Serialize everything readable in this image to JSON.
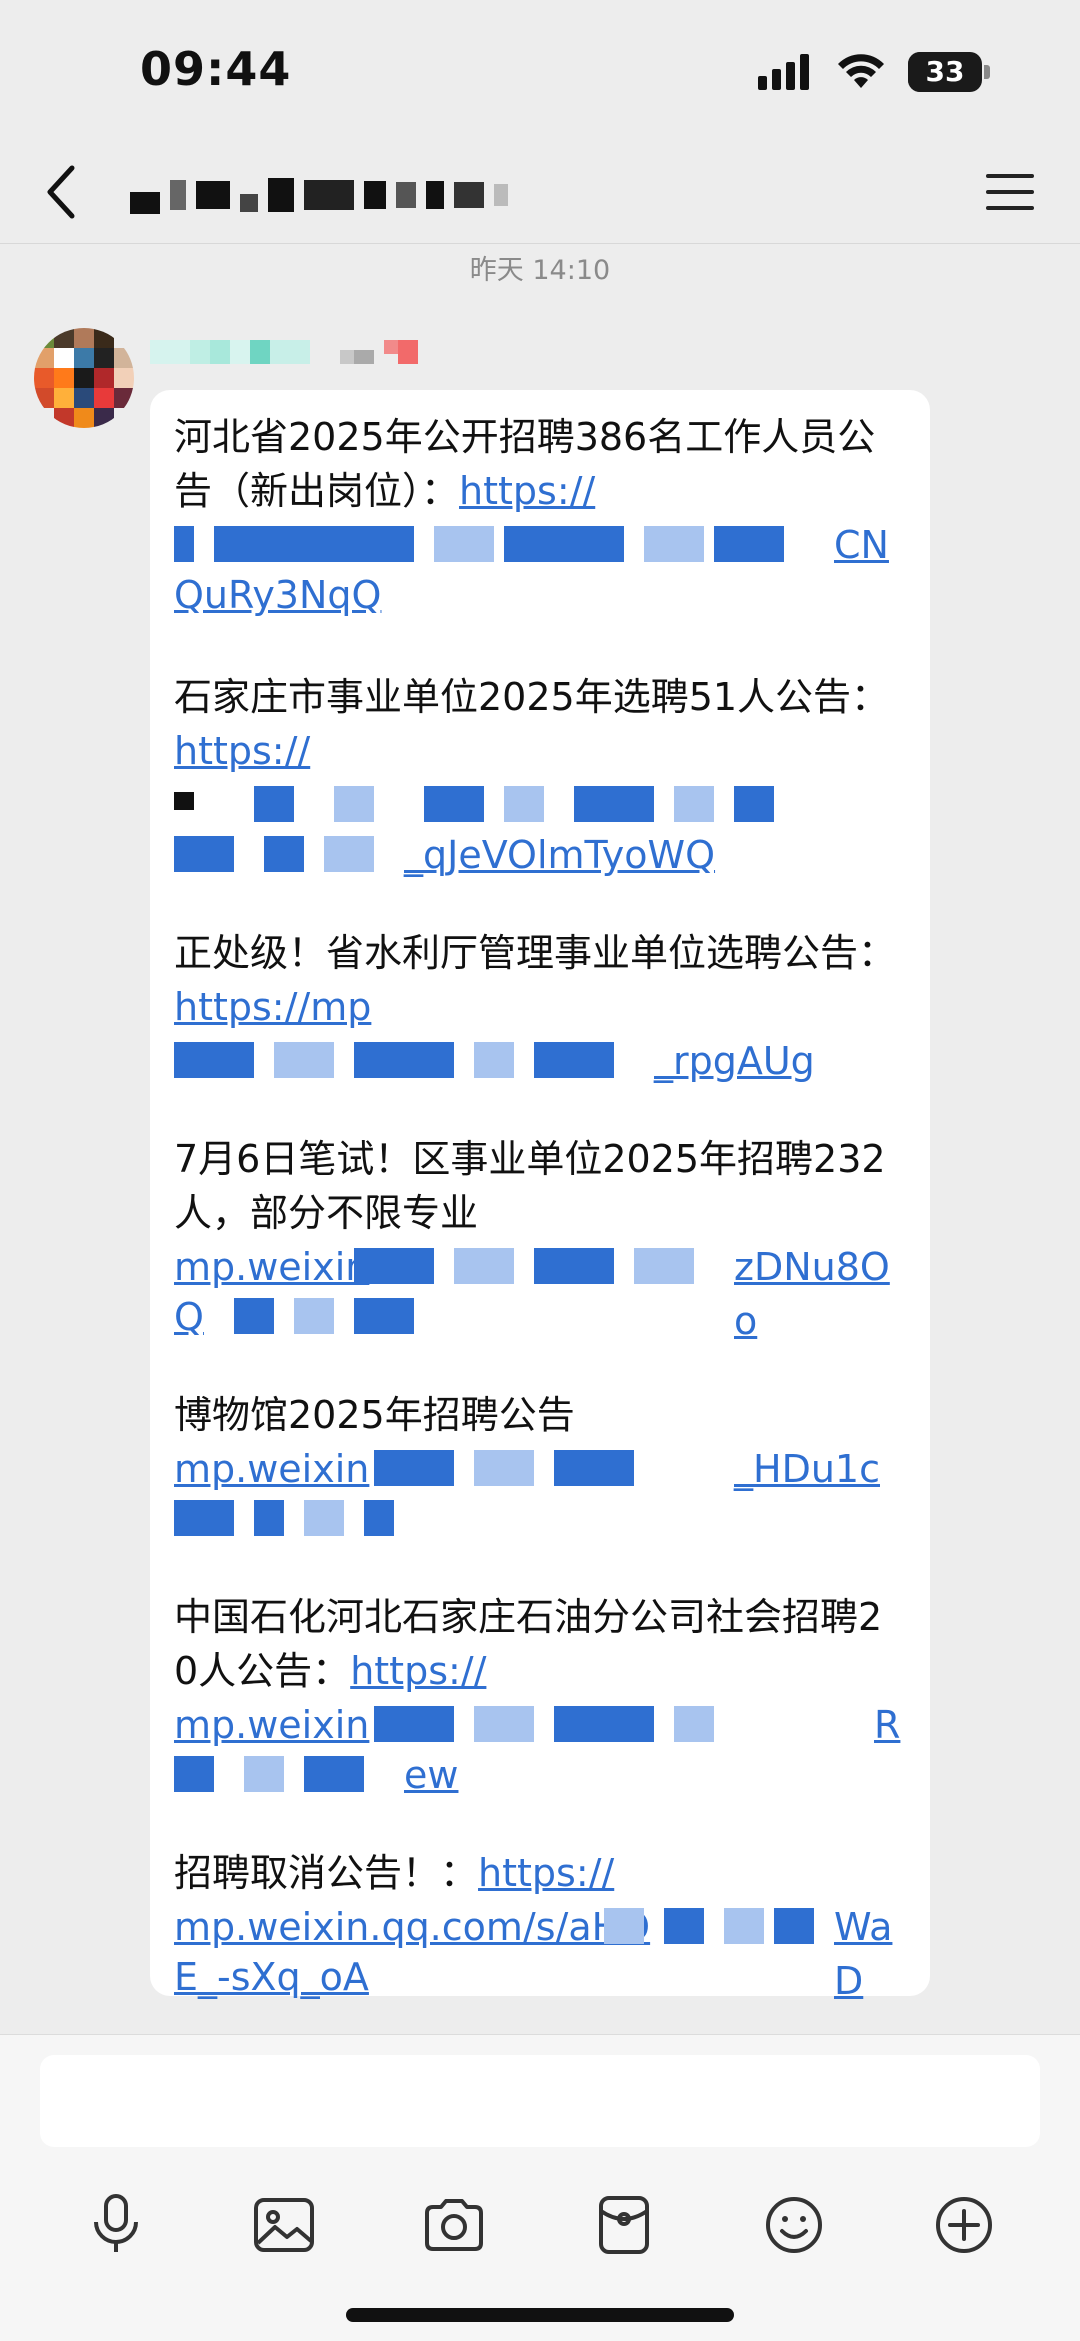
{
  "status_bar": {
    "time": "09:44",
    "battery_level": "33",
    "icons": [
      "signal-icon",
      "wifi-icon",
      "battery-icon"
    ]
  },
  "nav": {
    "back_icon": "chevron-left-icon",
    "title": "[redacted]",
    "menu_icon": "hamburger-menu-icon"
  },
  "chat": {
    "timestamp": "昨天 14:10",
    "sender_name": "[redacted]",
    "messages": [
      {
        "text": "河北省2025年公开招聘386名工作人员公告（新出岗位）：",
        "link_visible": "https://",
        "link_tail": "CN",
        "link_end": "QuRy3NqQ"
      },
      {
        "text": "石家庄市事业单位2025年选聘51人公告：",
        "link_visible": "https://",
        "link_end": "_qJeVOlmTyoWQ"
      },
      {
        "text": "正处级！省水利厅管理事业单位选聘公告：",
        "link_visible": "https://mp",
        "link_end": "_rpgAUg"
      },
      {
        "text": "7月6日笔试！区事业单位2025年招聘232人，部分不限专业",
        "link_visible": "mp.weixin",
        "link_tail": "zDNu8Oo",
        "link_end": "Q"
      },
      {
        "text": "博物馆2025年招聘公告",
        "link_visible": "mp.weixin",
        "link_tail": "_HDu1c",
        "link_end": ""
      },
      {
        "text": "中国石化河北石家庄石油分公司社会招聘20人公告：",
        "link_visible": "https://",
        "link_mid": "mp.weixin",
        "link_tail": "R",
        "link_end": "ew"
      },
      {
        "text": "招聘取消公告！：",
        "link_visible": "https://",
        "link_mid": "mp.weixin.qq.com/s/aHO",
        "link_tail": "WaD",
        "link_end": "E_-sXq_oA"
      }
    ]
  },
  "input": {
    "placeholder": ""
  },
  "toolbar": {
    "buttons": [
      "microphone-icon",
      "image-icon",
      "camera-icon",
      "red-packet-icon",
      "emoji-icon",
      "plus-icon"
    ]
  },
  "colors": {
    "background": "#ededed",
    "bubble": "#ffffff",
    "link": "#2f6fd1",
    "timestamp": "#8a8a8a"
  }
}
